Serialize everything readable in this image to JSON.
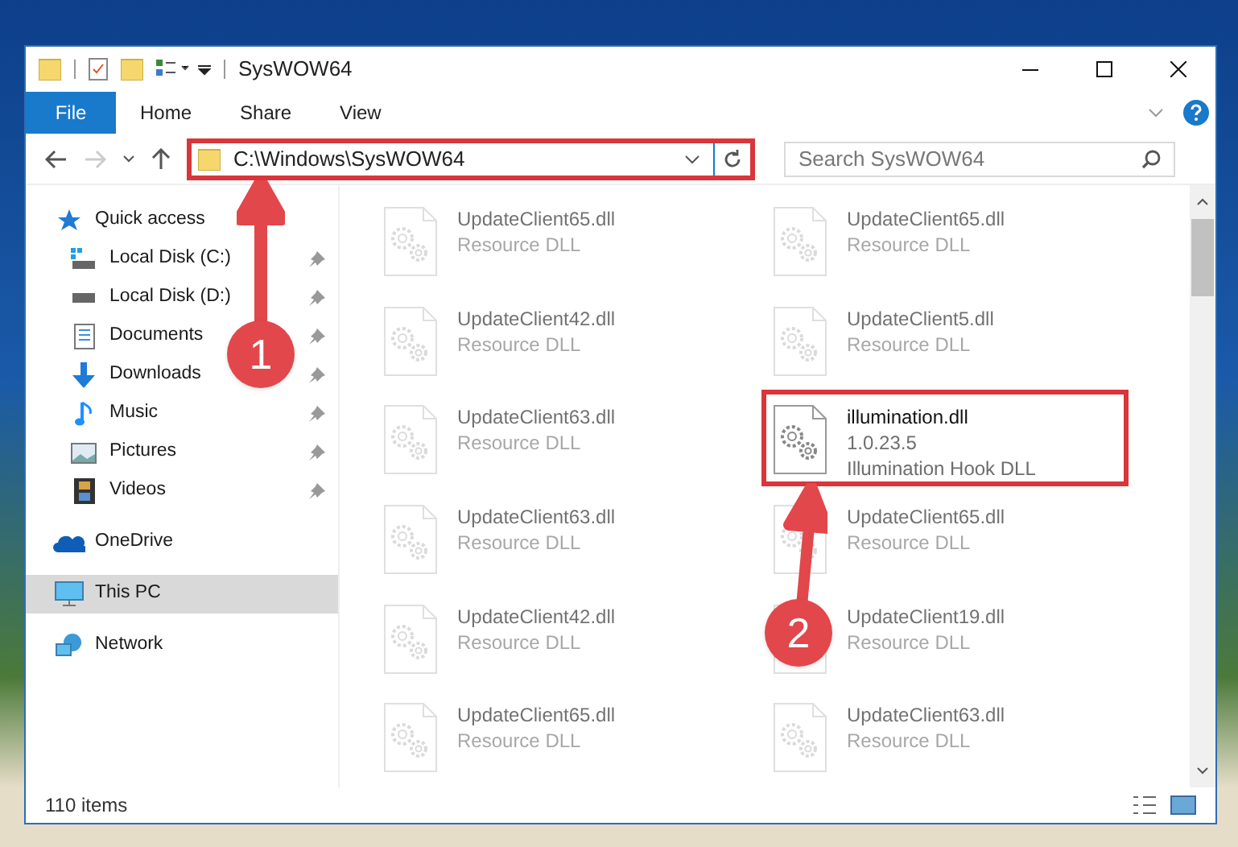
{
  "window": {
    "title": "SysWOW64"
  },
  "ribbon_tabs": [
    {
      "label": "File",
      "selected": true
    },
    {
      "label": "Home",
      "selected": false
    },
    {
      "label": "Share",
      "selected": false
    },
    {
      "label": "View",
      "selected": false
    }
  ],
  "address_bar": {
    "path": "C:\\Windows\\SysWOW64",
    "highlighted": true
  },
  "search": {
    "placeholder": "Search SysWOW64"
  },
  "sidebar": {
    "items": [
      {
        "label": "Quick access",
        "kind": "quick",
        "pinned": false,
        "selected": false,
        "children": [
          {
            "label": "Local Disk (C:)",
            "kind": "diskc",
            "pinned": true,
            "selected": false
          },
          {
            "label": "Local Disk (D:)",
            "kind": "disk",
            "pinned": true,
            "selected": false
          },
          {
            "label": "Documents",
            "kind": "documents",
            "pinned": true,
            "selected": false
          },
          {
            "label": "Downloads",
            "kind": "downloads",
            "pinned": true,
            "selected": false
          },
          {
            "label": "Music",
            "kind": "music",
            "pinned": true,
            "selected": false
          },
          {
            "label": "Pictures",
            "kind": "pictures",
            "pinned": true,
            "selected": false
          },
          {
            "label": "Videos",
            "kind": "videos",
            "pinned": true,
            "selected": false
          }
        ]
      },
      {
        "label": "OneDrive",
        "kind": "onedrive",
        "pinned": false,
        "selected": false
      },
      {
        "label": "This PC",
        "kind": "pc",
        "pinned": false,
        "selected": true
      },
      {
        "label": "Network",
        "kind": "network",
        "pinned": false,
        "selected": false
      }
    ]
  },
  "files": [
    {
      "name": "UpdateClient65.dll",
      "lines": [
        "Resource DLL"
      ],
      "faded": true,
      "highlighted": false
    },
    {
      "name": "UpdateClient65.dll",
      "lines": [
        "Resource DLL"
      ],
      "faded": true,
      "highlighted": false
    },
    {
      "name": "UpdateClient42.dll",
      "lines": [
        "Resource DLL"
      ],
      "faded": true,
      "highlighted": false
    },
    {
      "name": "UpdateClient5.dll",
      "lines": [
        "Resource DLL"
      ],
      "faded": true,
      "highlighted": false
    },
    {
      "name": "UpdateClient63.dll",
      "lines": [
        "Resource DLL"
      ],
      "faded": true,
      "highlighted": false
    },
    {
      "name": "illumination.dll",
      "lines": [
        "1.0.23.5",
        "Illumination Hook DLL"
      ],
      "faded": false,
      "highlighted": true
    },
    {
      "name": "UpdateClient63.dll",
      "lines": [
        "Resource DLL"
      ],
      "faded": true,
      "highlighted": false
    },
    {
      "name": "UpdateClient65.dll",
      "lines": [
        "Resource DLL"
      ],
      "faded": true,
      "highlighted": false
    },
    {
      "name": "UpdateClient42.dll",
      "lines": [
        "Resource DLL"
      ],
      "faded": true,
      "highlighted": false
    },
    {
      "name": "UpdateClient19.dll",
      "lines": [
        "Resource DLL"
      ],
      "faded": true,
      "highlighted": false
    },
    {
      "name": "UpdateClient65.dll",
      "lines": [
        "Resource DLL"
      ],
      "faded": true,
      "highlighted": false
    },
    {
      "name": "UpdateClient63.dll",
      "lines": [
        "Resource DLL"
      ],
      "faded": true,
      "highlighted": false
    }
  ],
  "status_bar": {
    "count": "110 items"
  },
  "callouts": [
    {
      "number": "1"
    },
    {
      "number": "2"
    }
  ]
}
